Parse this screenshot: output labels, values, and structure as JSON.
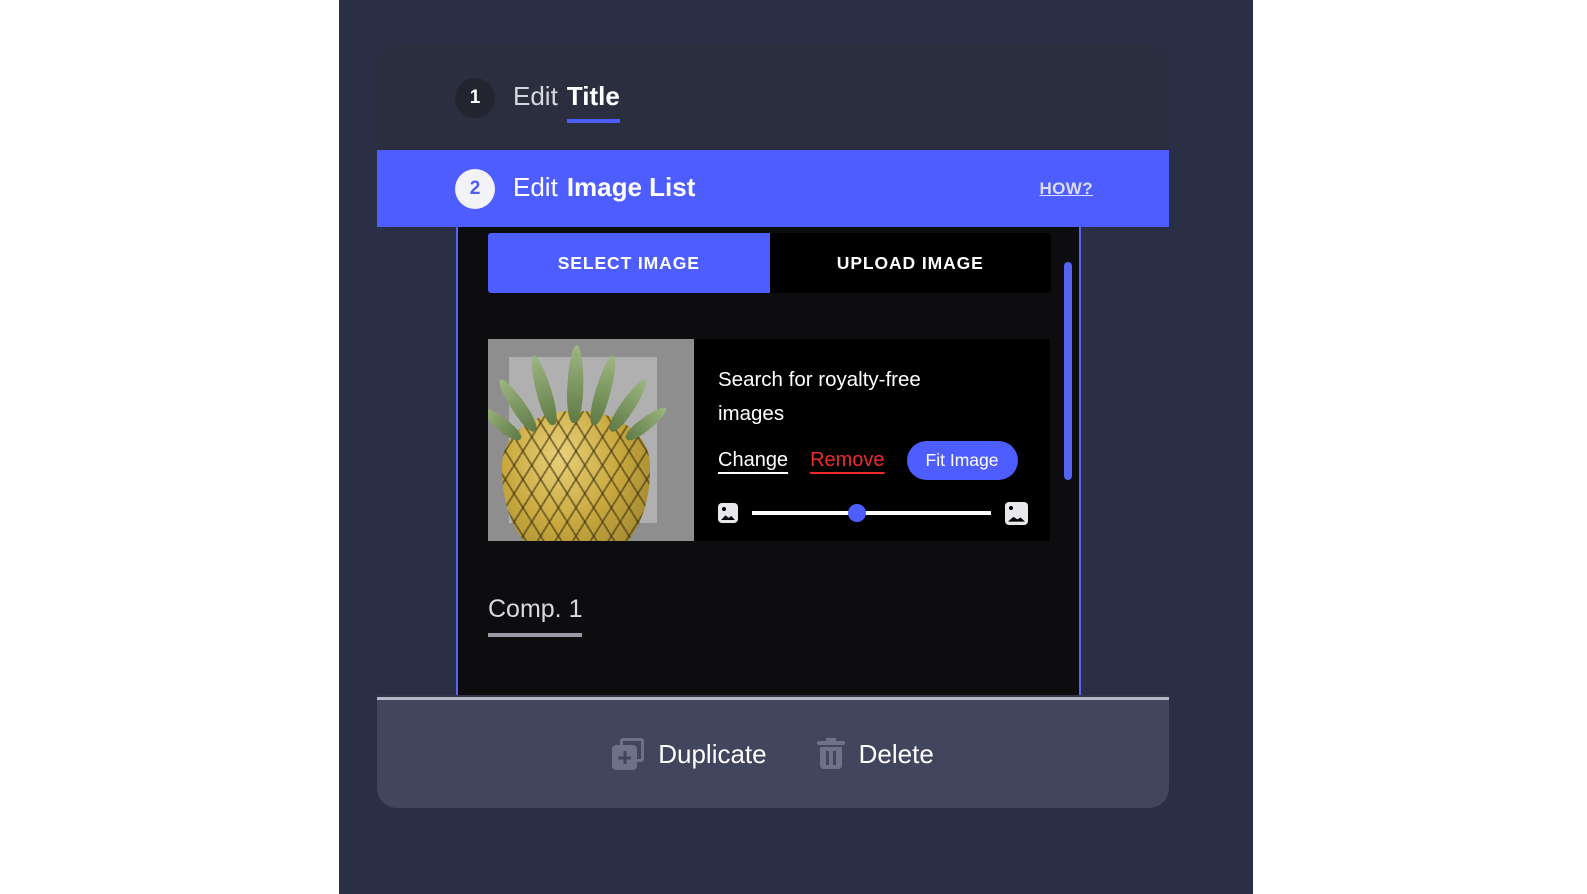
{
  "steps": [
    {
      "number": "1",
      "prefix": "Edit",
      "name": "Title"
    },
    {
      "number": "2",
      "prefix": "Edit",
      "name": "Image List",
      "link": "HOW?"
    }
  ],
  "tabs": [
    {
      "label": "SELECT IMAGE",
      "active": true
    },
    {
      "label": "UPLOAD IMAGE",
      "active": false
    }
  ],
  "image_card": {
    "title": "Search for royalty-free images",
    "change_label": "Change",
    "remove_label": "Remove",
    "fit_label": "Fit Image",
    "slider_value": "44"
  },
  "comp": {
    "label": "Comp. 1"
  },
  "footer": {
    "duplicate_label": "Duplicate",
    "delete_label": "Delete"
  },
  "colors": {
    "accent": "#4d5dff",
    "danger": "#ef2b2b",
    "card_bg": "#30344a",
    "content_bg": "#0d0d10",
    "stage_bg": "#2b2f45",
    "footer_bg": "#41455d"
  }
}
